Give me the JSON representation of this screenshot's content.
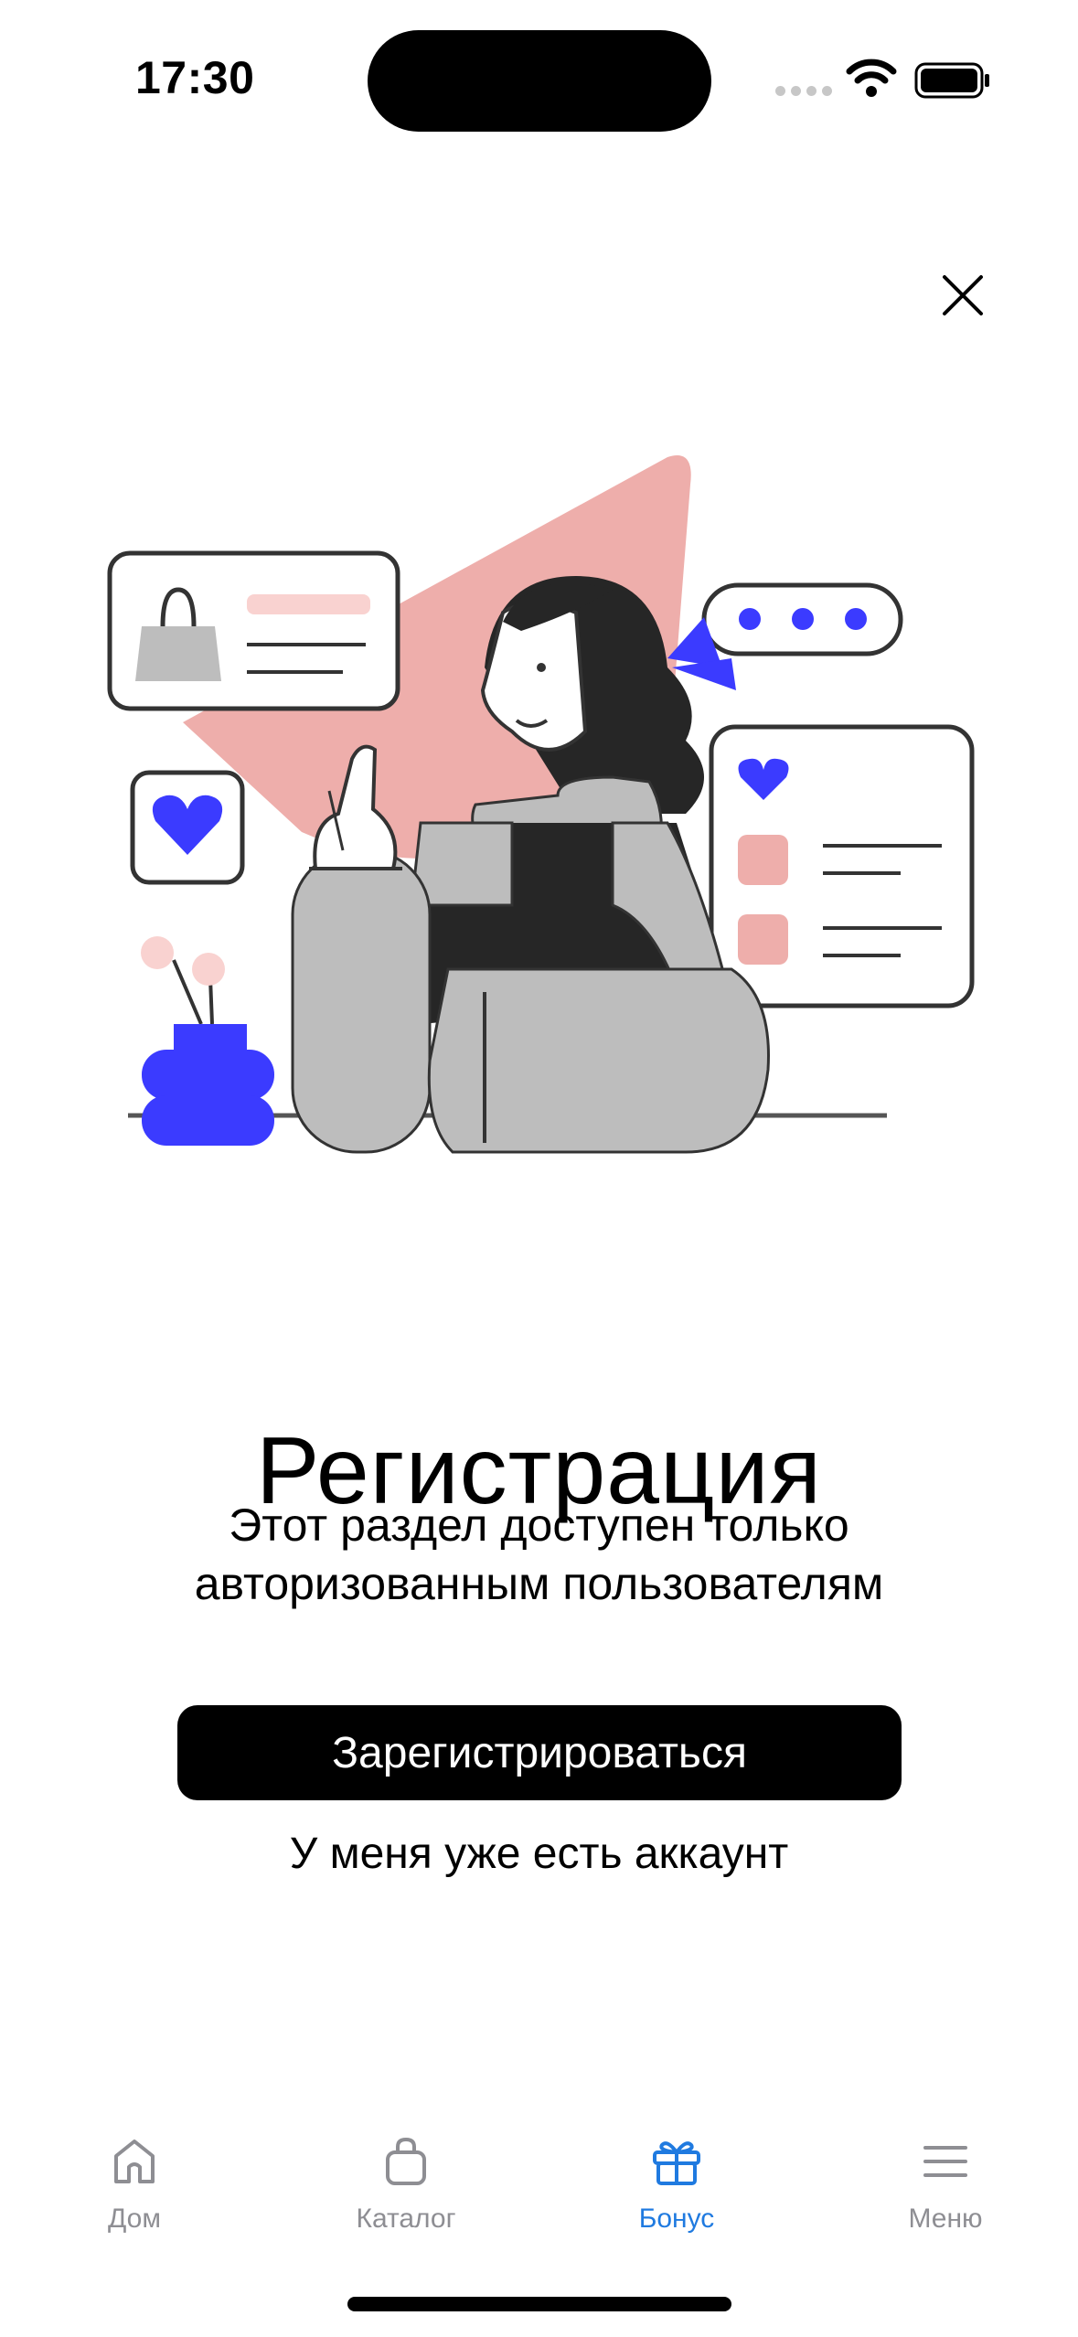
{
  "status_bar": {
    "time": "17:30"
  },
  "content": {
    "title": "Регистрация",
    "subtitle_line1": "Этот раздел доступен только",
    "subtitle_line2": "авторизованным пользователям",
    "register_label": "Зарегистрироваться",
    "login_label": "У меня уже есть аккаунт"
  },
  "tabs": [
    {
      "label": "Дом",
      "icon": "house-icon",
      "active": false
    },
    {
      "label": "Каталог",
      "icon": "shopping-bag-icon",
      "active": false
    },
    {
      "label": "Бонус",
      "icon": "gift-icon",
      "active": true
    },
    {
      "label": "Меню",
      "icon": "menu-icon",
      "active": false
    }
  ],
  "colors": {
    "accent": "#1f7ae0",
    "illustration_pink": "#eeaeab",
    "illustration_blue": "#3b3bff",
    "illustration_gray": "#bdbdbd",
    "primary_button": "#000000"
  }
}
